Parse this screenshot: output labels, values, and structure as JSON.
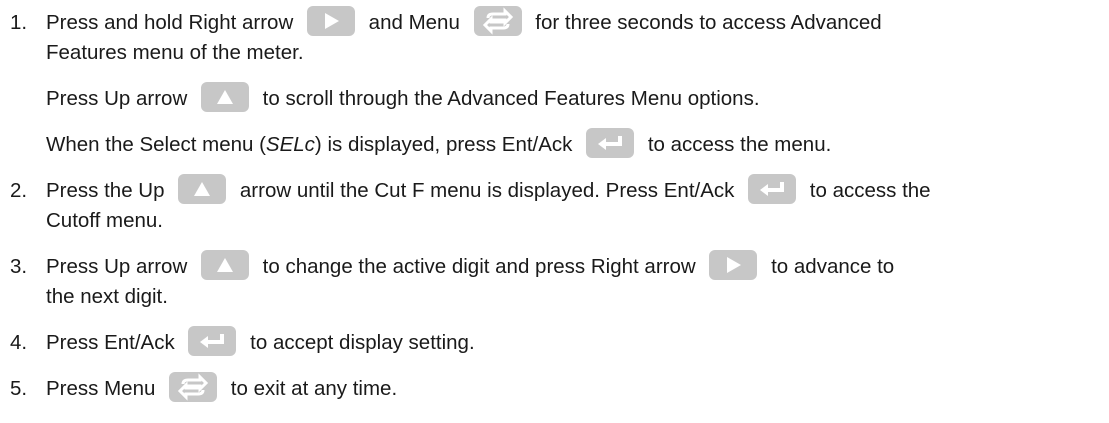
{
  "steps": [
    {
      "number": "1.",
      "lines": [
        {
          "a": "Press and hold Right arrow",
          "b": "and Menu",
          "c": "for three seconds to access Advanced"
        },
        {
          "a": "Features menu of the meter."
        }
      ],
      "extra": [
        {
          "a": "Press Up arrow",
          "b": "to scroll through the Advanced Features Menu options."
        },
        {
          "a": "When the Select menu (",
          "italic": "SELc",
          "b": ") is displayed, press Ent/Ack",
          "c": "to access the menu."
        }
      ]
    },
    {
      "number": "2.",
      "lines": [
        {
          "a": "Press the Up",
          "b": "arrow until the Cut F menu is displayed. Press Ent/Ack",
          "c": "to access the"
        },
        {
          "a": "Cutoff menu."
        }
      ]
    },
    {
      "number": "3.",
      "lines": [
        {
          "a": "Press Up arrow",
          "b": "to change the active digit and press Right arrow",
          "c": "to advance to"
        },
        {
          "a": "the next digit."
        }
      ]
    },
    {
      "number": "4.",
      "lines": [
        {
          "a": "Press Ent/Ack",
          "b": "to accept display setting."
        }
      ]
    },
    {
      "number": "5.",
      "lines": [
        {
          "a": "Press Menu",
          "b": "to exit at any time."
        }
      ]
    }
  ],
  "icons": {
    "right": "right-arrow-key-icon",
    "menu": "menu-key-icon",
    "up": "up-arrow-key-icon",
    "enter": "enter-ack-key-icon"
  }
}
